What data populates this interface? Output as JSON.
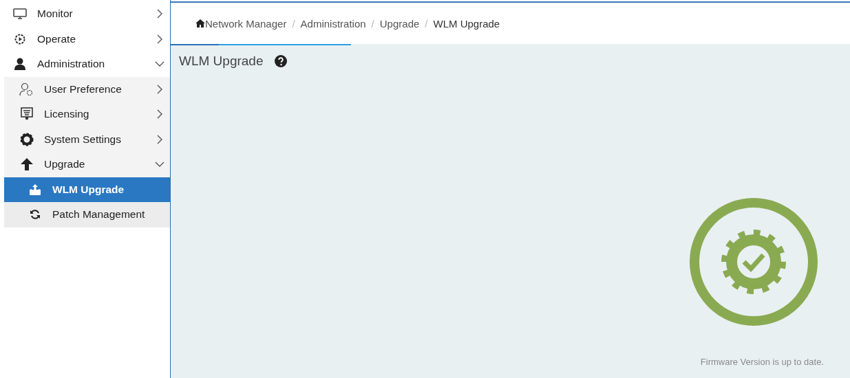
{
  "sidebar": {
    "items": [
      {
        "label": "Monitor",
        "expanded": false,
        "selected": false
      },
      {
        "label": "Operate",
        "expanded": false,
        "selected": false
      },
      {
        "label": "Administration",
        "expanded": true,
        "selected": false,
        "children": [
          {
            "label": "User Preference",
            "expanded": false,
            "selected": false
          },
          {
            "label": "Licensing",
            "expanded": false,
            "selected": false
          },
          {
            "label": "System Settings",
            "expanded": false,
            "selected": false
          },
          {
            "label": "Upgrade",
            "expanded": true,
            "selected": false,
            "children": [
              {
                "label": "WLM Upgrade",
                "selected": true
              },
              {
                "label": "Patch Management",
                "selected": false
              }
            ]
          }
        ]
      }
    ]
  },
  "breadcrumb": [
    {
      "label": "Network Manager"
    },
    {
      "separator": "/",
      "label": "Administration"
    },
    {
      "separator": "/",
      "label": "Upgrade"
    },
    {
      "separator": "/",
      "label": "WLM Upgrade"
    }
  ],
  "page": {
    "title": "WLM Upgrade",
    "status": "Firmware Version is up to date."
  }
}
